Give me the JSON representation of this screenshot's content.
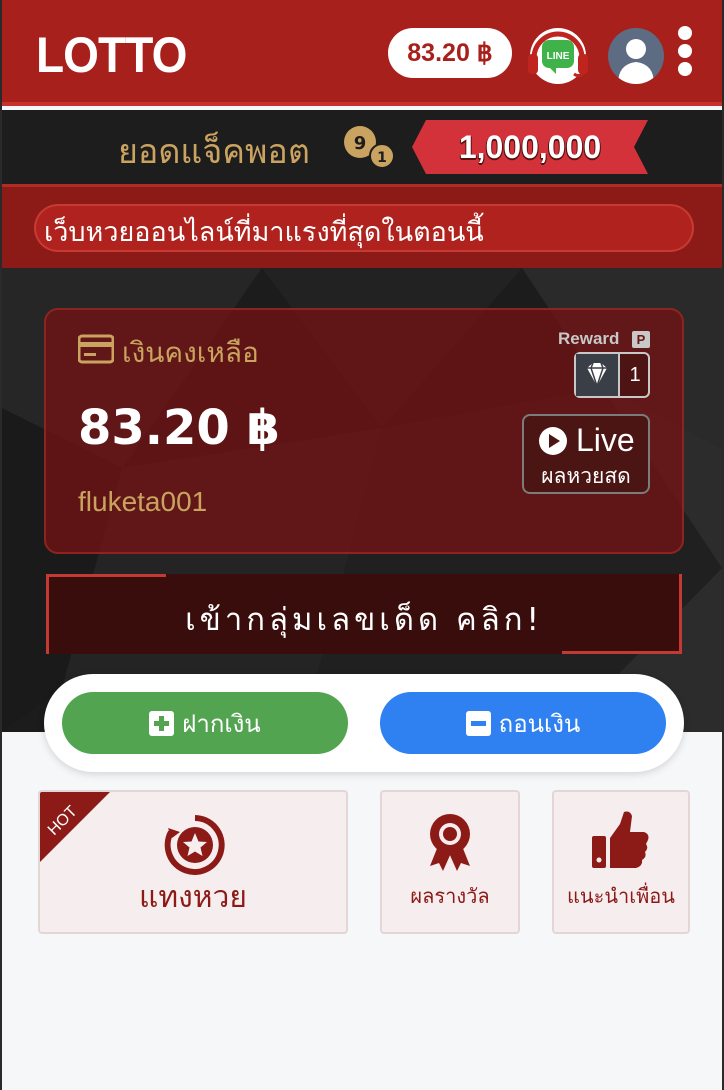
{
  "header": {
    "logo": "LOTTO",
    "balance": "83.20 ฿",
    "line_badge": "LINE"
  },
  "jackpot": {
    "label": "ยอดแจ็คพอต",
    "amount": "1,000,000",
    "balls": [
      "9",
      "1"
    ]
  },
  "marquee": {
    "text": "เว็บหวยออนไลน์ที่มาแรงที่สุดในตอนนี้"
  },
  "balance_card": {
    "label": "เงินคงเหลือ",
    "amount": "83.20 ฿",
    "username": "fluketa001",
    "reward_label": "Reward",
    "reward_badge": "P",
    "reward_count": "1",
    "live_label": "Live",
    "live_sub": "ผลหวยสด"
  },
  "join_banner": {
    "text": "เข้ากลุ่มเลขเด็ด คลิก!"
  },
  "actions": {
    "deposit": "ฝากเงิน",
    "withdraw": "ถอนเงิน"
  },
  "menu": {
    "hot_badge": "HOT",
    "bet": "แทงหวย",
    "results": "ผลรางวัล",
    "invite": "แนะนำเพื่อน"
  },
  "colors": {
    "header_red": "#a8201b",
    "gold": "#c9a35f",
    "deposit_green": "#53a451",
    "withdraw_blue": "#2f80f0",
    "dark_red_text": "#8c1a17"
  }
}
